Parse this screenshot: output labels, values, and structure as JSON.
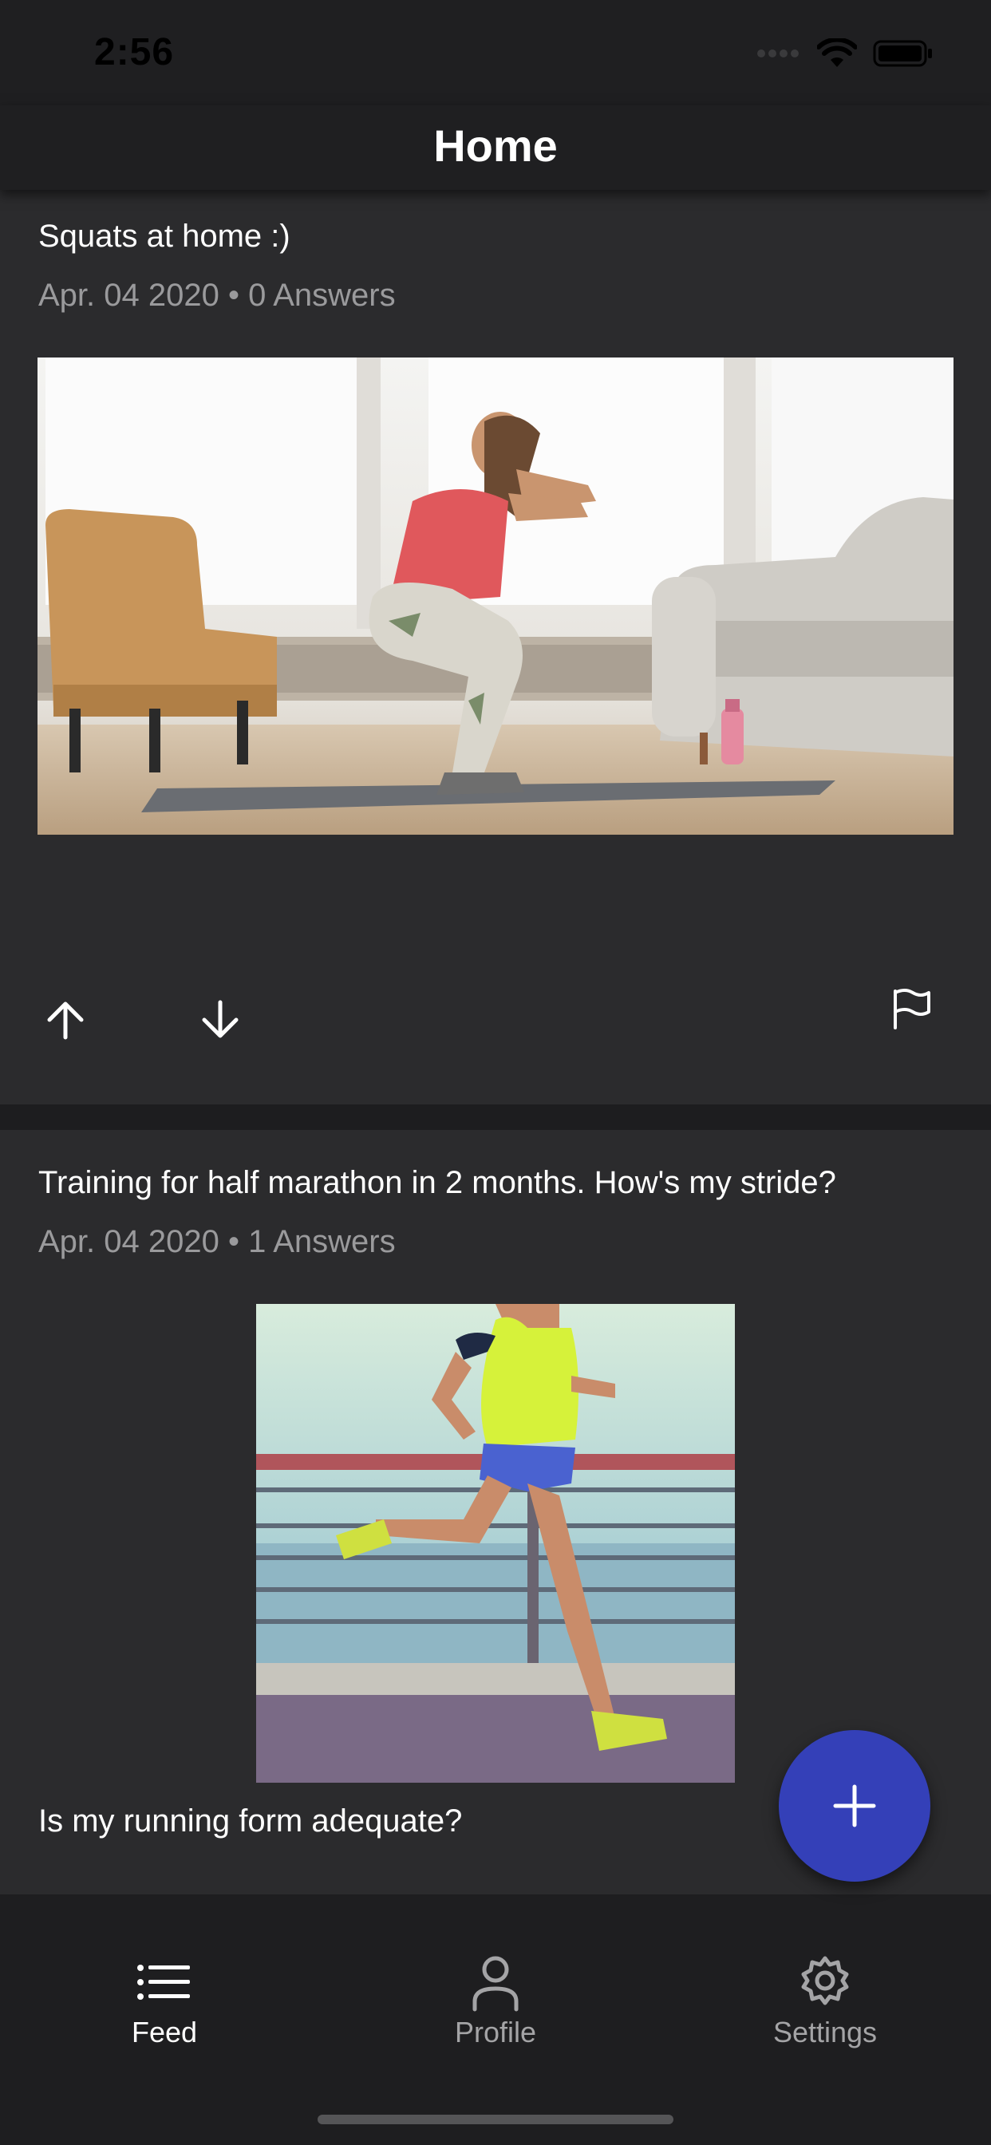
{
  "status_bar": {
    "time": "2:56"
  },
  "header": {
    "title": "Home"
  },
  "posts": [
    {
      "title": "Squats at home :)",
      "meta": "Apr. 04 2020 • 0 Answers",
      "image_icon": "woman-doing-squats-photo",
      "actions": {
        "upvote": "arrow-up-icon",
        "downvote": "arrow-down-icon",
        "report": "flag-icon"
      }
    },
    {
      "title": "Training for half marathon in 2 months. How's my stride?",
      "meta": "Apr. 04 2020 • 1 Answers",
      "image_icon": "woman-running-photo",
      "body": "Is my running form adequate?"
    }
  ],
  "fab": {
    "icon": "plus-icon",
    "color": "#3440b8"
  },
  "bottom_nav": {
    "items": [
      {
        "label": "Feed",
        "icon": "list-icon",
        "active": true
      },
      {
        "label": "Profile",
        "icon": "person-icon",
        "active": false
      },
      {
        "label": "Settings",
        "icon": "gear-icon",
        "active": false
      }
    ]
  },
  "colors": {
    "background": "#2b2b2d",
    "bar": "#1f1f21",
    "accent": "#3440b8",
    "meta_text": "#9a9a9c"
  }
}
